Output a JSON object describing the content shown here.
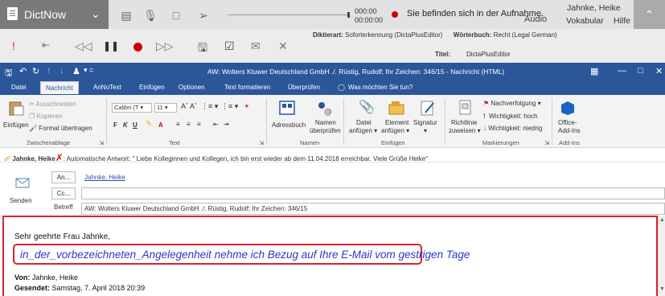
{
  "dictnow": {
    "app_name": "DictNow",
    "time_position": "000:00",
    "time_total": "00:00:00",
    "status_text": "Sie befinden sich in der Aufnahme.",
    "audio_label": "Audio",
    "user_name": "Jahnke, Heike",
    "vocab_label": "Vokabular",
    "help_label": "Hilfe",
    "dictation_type_label": "Diktierart:",
    "dictation_type_value": "Soforterkennung (DictaPlusEditor)",
    "dictionary_label": "Wörterbuch:",
    "dictionary_value": "Recht (Legal German)",
    "title_label": "Titel:",
    "title_value": "DictaPlusEditor",
    "record_color": "#d00000"
  },
  "outlook": {
    "window_title": "AW: Wolters Kluwer Deutschland GmbH ./. Rüstig, Rudolf; Ihr Zeichen: 346/15 - Nachricht (HTML)",
    "tabs": [
      "Datei",
      "Nachricht",
      "AnNoText",
      "Einfügen",
      "Optionen",
      "Text formatieren",
      "Überprüfen",
      "Was möchten Sie tun?"
    ],
    "ribbon": {
      "cut": "Ausschneiden",
      "copy": "Kopieren",
      "paste": "Einfügen",
      "format_painter": "Format übertragen",
      "clipboard_group": "Zwischenablage",
      "font_name": "Calibri (T",
      "font_size": "11",
      "text_group": "Text",
      "addressbook": "Adressbuch",
      "check_names_1": "Namen",
      "check_names_2": "überprüfen",
      "names_group": "Namen",
      "attach_file_1": "Datei",
      "attach_file_2": "anfügen",
      "attach_item_1": "Element",
      "attach_item_2": "anfügen",
      "signature": "Signatur",
      "insert_group": "Einfügen",
      "policy_1": "Richtlinie",
      "policy_2": "zuweisen",
      "followup": "Nachverfolgung",
      "high_importance": "Wichtigkeit: hoch",
      "low_importance": "Wichtigkeit: niedrig",
      "tags_group": "Markierungen",
      "office_addins_1": "Office-",
      "office_addins_2": "Add-Ins",
      "addins_group": "Add-Ins"
    },
    "autoreply": {
      "sender": "Jahnke, Heike",
      "text": ": Automatische Antwort: \" Liebe Kolleginnen und Kollegen,   ich bin erst wieder ab dem 11.04.2018 erreichbar.   Viele Grüße Heike\""
    },
    "header": {
      "send_label": "Senden",
      "to_button": "An...",
      "cc_button": "Cc...",
      "subject_label": "Betreff",
      "to_value": "Jahnke, Heike",
      "cc_value": "",
      "subject_value": "AW: Wolters Kluwer Deutschland GmbH ./. Rüstig, Rudolf; Ihr Zeichen: 346/15"
    },
    "body": {
      "greeting": "Sehr geehrte Frau Jahnke,",
      "dictated_text": "in_der_vorbezeichneten_Angelegenheit nehme ich Bezug auf Ihre E-Mail vom gestrigen Tage",
      "from_label": "Von:",
      "from_value": "Jahnke, Heike",
      "sent_label": "Gesendet:",
      "sent_value": "Samstag, 7. April 2018 20:39"
    },
    "accent_color": "#2b579a",
    "highlight_color": "#d6242e"
  }
}
